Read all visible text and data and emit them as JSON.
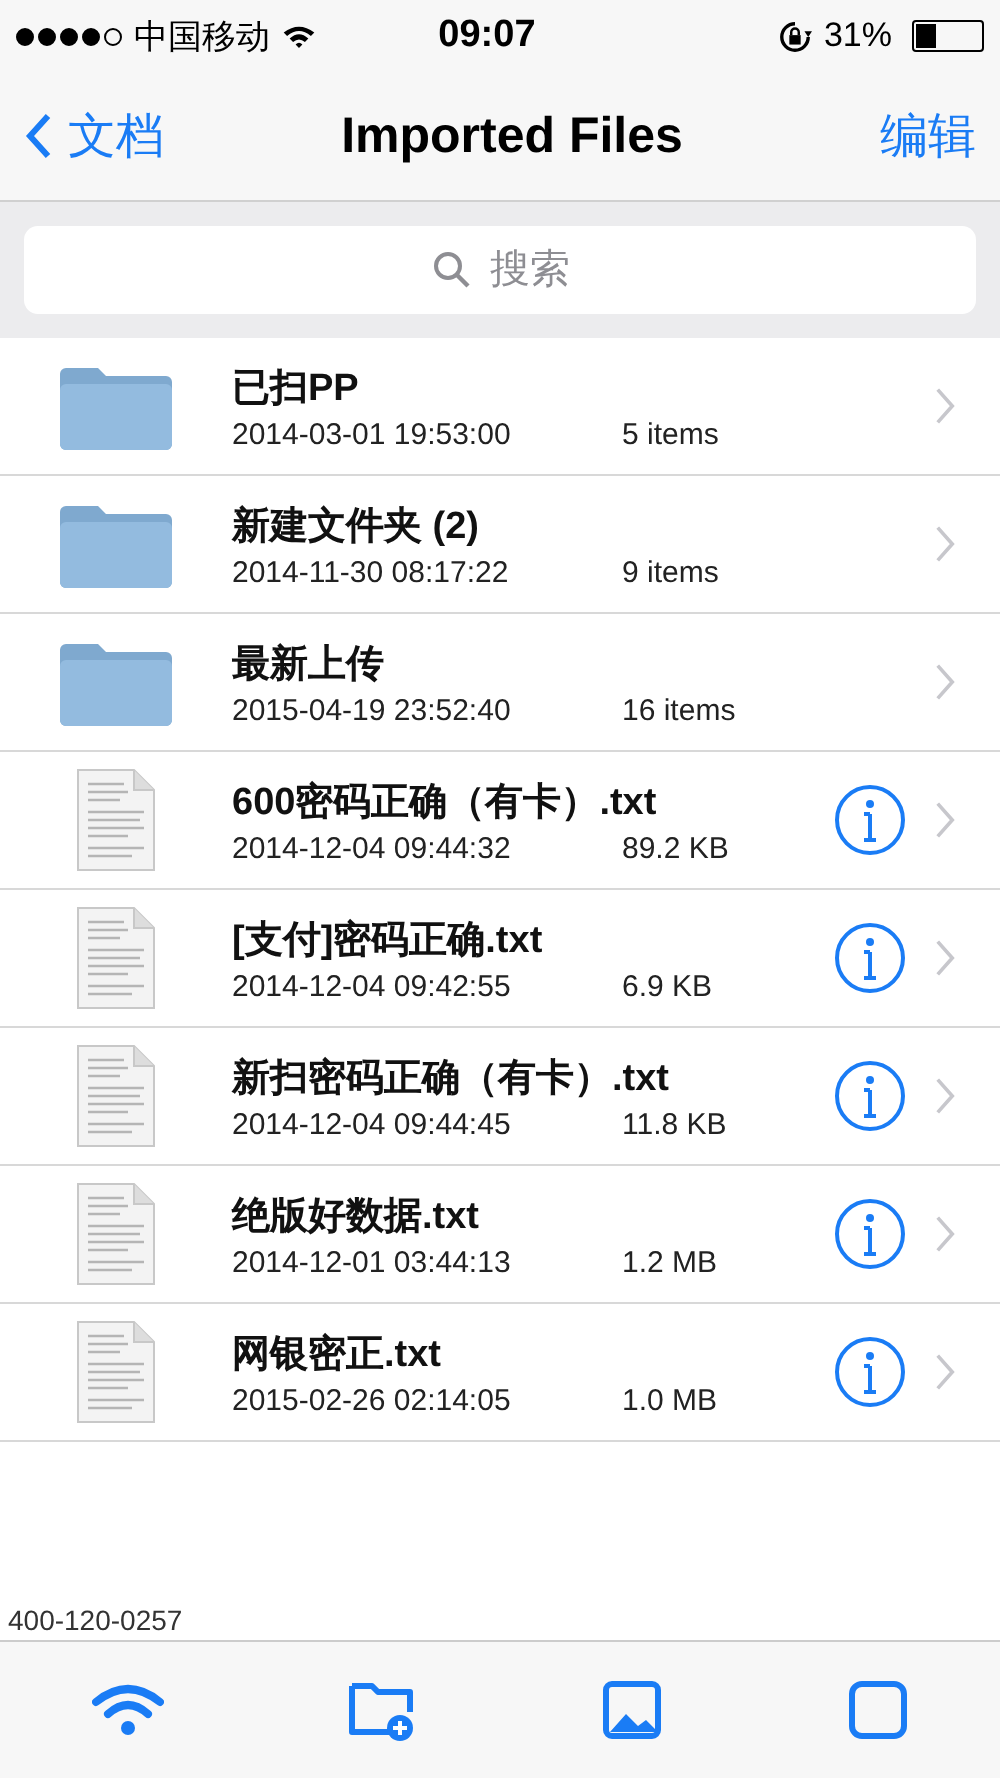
{
  "status_bar": {
    "carrier": "中国移动",
    "time": "09:07",
    "battery": "31%"
  },
  "nav": {
    "back": "文档",
    "title": "Imported Files",
    "edit": "编辑"
  },
  "search": {
    "placeholder": "搜索"
  },
  "files": [
    {
      "kind": "folder",
      "name": "已扫PP",
      "date": "2014-03-01 19:53:00",
      "size": "5 items"
    },
    {
      "kind": "folder",
      "name": "新建文件夹 (2)",
      "date": "2014-11-30 08:17:22",
      "size": "9 items"
    },
    {
      "kind": "folder",
      "name": "最新上传",
      "date": "2015-04-19 23:52:40",
      "size": "16 items"
    },
    {
      "kind": "text",
      "name": "600密码正确（有卡）.txt",
      "date": "2014-12-04 09:44:32",
      "size": "89.2 KB"
    },
    {
      "kind": "text",
      "name": "[支付]密码正确.txt",
      "date": "2014-12-04 09:42:55",
      "size": "6.9 KB"
    },
    {
      "kind": "text",
      "name": "新扫密码正确（有卡）.txt",
      "date": "2014-12-04 09:44:45",
      "size": "11.8 KB"
    },
    {
      "kind": "text",
      "name": "绝版好数据.txt",
      "date": "2014-12-01 03:44:13",
      "size": "1.2 MB"
    },
    {
      "kind": "text",
      "name": "网银密正.txt",
      "date": "2015-02-26 02:14:05",
      "size": "1.0 MB"
    }
  ],
  "behind_text": "400-120-0257"
}
